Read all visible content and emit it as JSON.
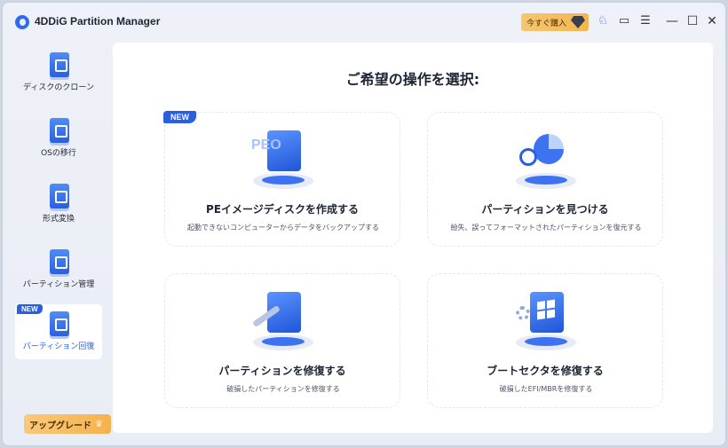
{
  "app": {
    "title": "4DDiG Partition Manager",
    "buy_label": "今すぐ購入",
    "accent": "#2a5fe0"
  },
  "titlebar": {
    "icons": [
      "pin-icon",
      "feedback-icon",
      "menu-icon"
    ],
    "controls": [
      "minimize-icon",
      "maximize-icon",
      "close-icon"
    ]
  },
  "sidebar": {
    "items": [
      {
        "label": "ディスクのクローン",
        "icon": "disk-clone-icon"
      },
      {
        "label": "OSの移行",
        "icon": "os-migrate-icon"
      },
      {
        "label": "形式変換",
        "icon": "convert-icon"
      },
      {
        "label": "パーティション管理",
        "icon": "partition-manage-icon"
      },
      {
        "label": "パーティション回復",
        "icon": "partition-recover-icon",
        "tag": "NEW",
        "active": true
      }
    ],
    "upgrade_label": "アップグレード"
  },
  "main": {
    "title": "ご希望の操作を選択:",
    "cards": [
      {
        "title": "PEイメージディスクを作成する",
        "desc": "起動できないコンピューターからデータをバックアップする",
        "tag": "NEW"
      },
      {
        "title": "パーティションを見つける",
        "desc": "紛失、誤ってフォーマットされたパーティションを復元する"
      },
      {
        "title": "パーティションを修復する",
        "desc": "破損したパーティションを修復する"
      },
      {
        "title": "ブートセクタを修復する",
        "desc": "破損したEFI/MBRを修復する"
      }
    ]
  }
}
